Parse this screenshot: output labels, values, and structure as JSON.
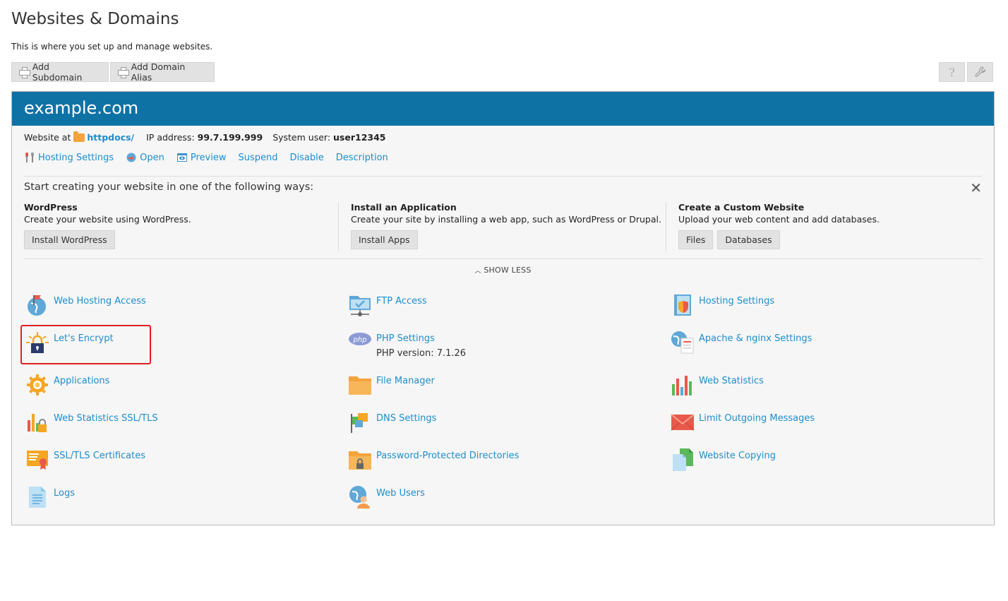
{
  "header": {
    "title": "Websites & Domains",
    "description": "This is where you set up and manage websites."
  },
  "toolbar": {
    "add_subdomain": "Add Subdomain",
    "add_domain_alias": "Add Domain Alias",
    "help_icon": "question-icon",
    "settings_icon": "wrench-icon"
  },
  "domain": {
    "name": "example.com",
    "website_at_label": "Website at",
    "httpdocs": "httpdocs/",
    "ip_label": "IP address:",
    "ip_value": "99.7.199.999",
    "user_label": "System user:",
    "user_value": "user12345"
  },
  "actions": {
    "hosting_settings": "Hosting Settings",
    "open": "Open",
    "preview": "Preview",
    "suspend": "Suspend",
    "disable": "Disable",
    "description": "Description"
  },
  "start": {
    "title": "Start creating your website in one of the following ways:",
    "wordpress": {
      "title": "WordPress",
      "desc": "Create your website using WordPress.",
      "button": "Install WordPress"
    },
    "app": {
      "title": "Install an Application",
      "desc": "Create your site by installing a web app, such as WordPress or Drupal.",
      "button": "Install Apps"
    },
    "custom": {
      "title": "Create a Custom Website",
      "desc": "Upload your web content and add databases.",
      "button_files": "Files",
      "button_db": "Databases"
    },
    "show_less": "SHOW LESS"
  },
  "tools": {
    "col1": [
      "Web Hosting Access",
      "Let's Encrypt",
      "Applications",
      "Web Statistics SSL/TLS",
      "SSL/TLS Certificates",
      "Logs"
    ],
    "col2": [
      "FTP Access",
      "PHP Settings",
      "File Manager",
      "DNS Settings",
      "Password-Protected Directories",
      "Web Users"
    ],
    "col3": [
      "Hosting Settings",
      "Apache & nginx Settings",
      "Web Statistics",
      "Limit Outgoing Messages",
      "Website Copying"
    ],
    "php_version": "PHP version: 7.1.26",
    "php_badge": "php"
  },
  "colors": {
    "accent": "#0f72a5",
    "link": "#1e8dcb",
    "highlight": "#e31e24"
  }
}
